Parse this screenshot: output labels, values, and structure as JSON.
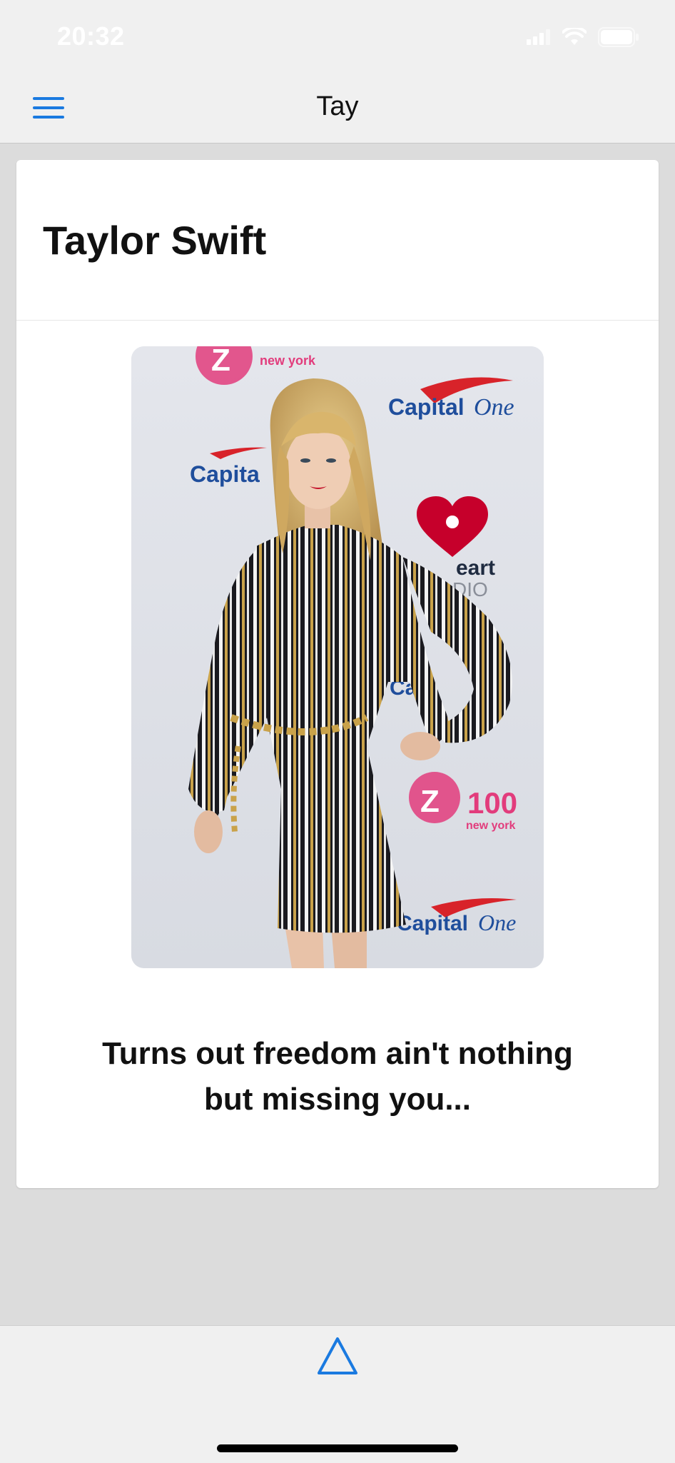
{
  "status_bar": {
    "time": "20:32",
    "icons": [
      "signal-icon",
      "wifi-icon",
      "battery-icon"
    ]
  },
  "nav": {
    "title": "Tay",
    "menu_icon": "hamburger-menu-icon"
  },
  "card": {
    "title": "Taylor Swift",
    "photo": {
      "subject": "Taylor Swift",
      "backdrop_logos": [
        "Z100",
        "new york",
        "Capital",
        "Capital One",
        "iHeart",
        "RADIO"
      ]
    },
    "quote": "Turns out freedom ain't nothing but missing you..."
  },
  "tab_bar": {
    "icons": [
      "triangle-icon"
    ]
  },
  "colors": {
    "accent": "#1a7ae0",
    "background": "#dcdcdc",
    "bar_background": "#f0f0f0",
    "card_background": "#ffffff"
  }
}
